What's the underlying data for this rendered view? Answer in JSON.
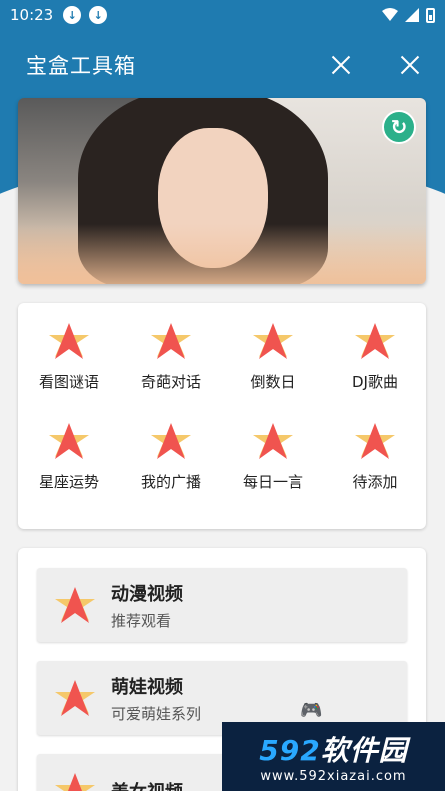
{
  "status_bar": {
    "time": "10:23"
  },
  "app_bar": {
    "title": "宝盒工具箱"
  },
  "grid": {
    "items": [
      {
        "label": "看图谜语"
      },
      {
        "label": "奇葩对话"
      },
      {
        "label": "倒数日"
      },
      {
        "label": "DJ歌曲"
      },
      {
        "label": "星座运势"
      },
      {
        "label": "我的广播"
      },
      {
        "label": "每日一言"
      },
      {
        "label": "待添加"
      }
    ]
  },
  "list": {
    "items": [
      {
        "title": "动漫视频",
        "subtitle": "推荐观看"
      },
      {
        "title": "萌娃视频",
        "subtitle": "可爱萌娃系列"
      },
      {
        "title": "美女视频",
        "subtitle": ""
      }
    ]
  },
  "watermark": {
    "brand_num": "592",
    "brand_text": "软件园",
    "url": "www.592xiazai.com"
  },
  "colors": {
    "header": "#1f7bb0",
    "star_main": "#f0544f",
    "star_back": "#f5c86a",
    "refresh": "#2bb08a"
  },
  "icons": {
    "star": "star-icon",
    "refresh": "refresh-icon",
    "close": "close-icon",
    "download": "download-icon",
    "gamepad": "gamepad-icon"
  }
}
